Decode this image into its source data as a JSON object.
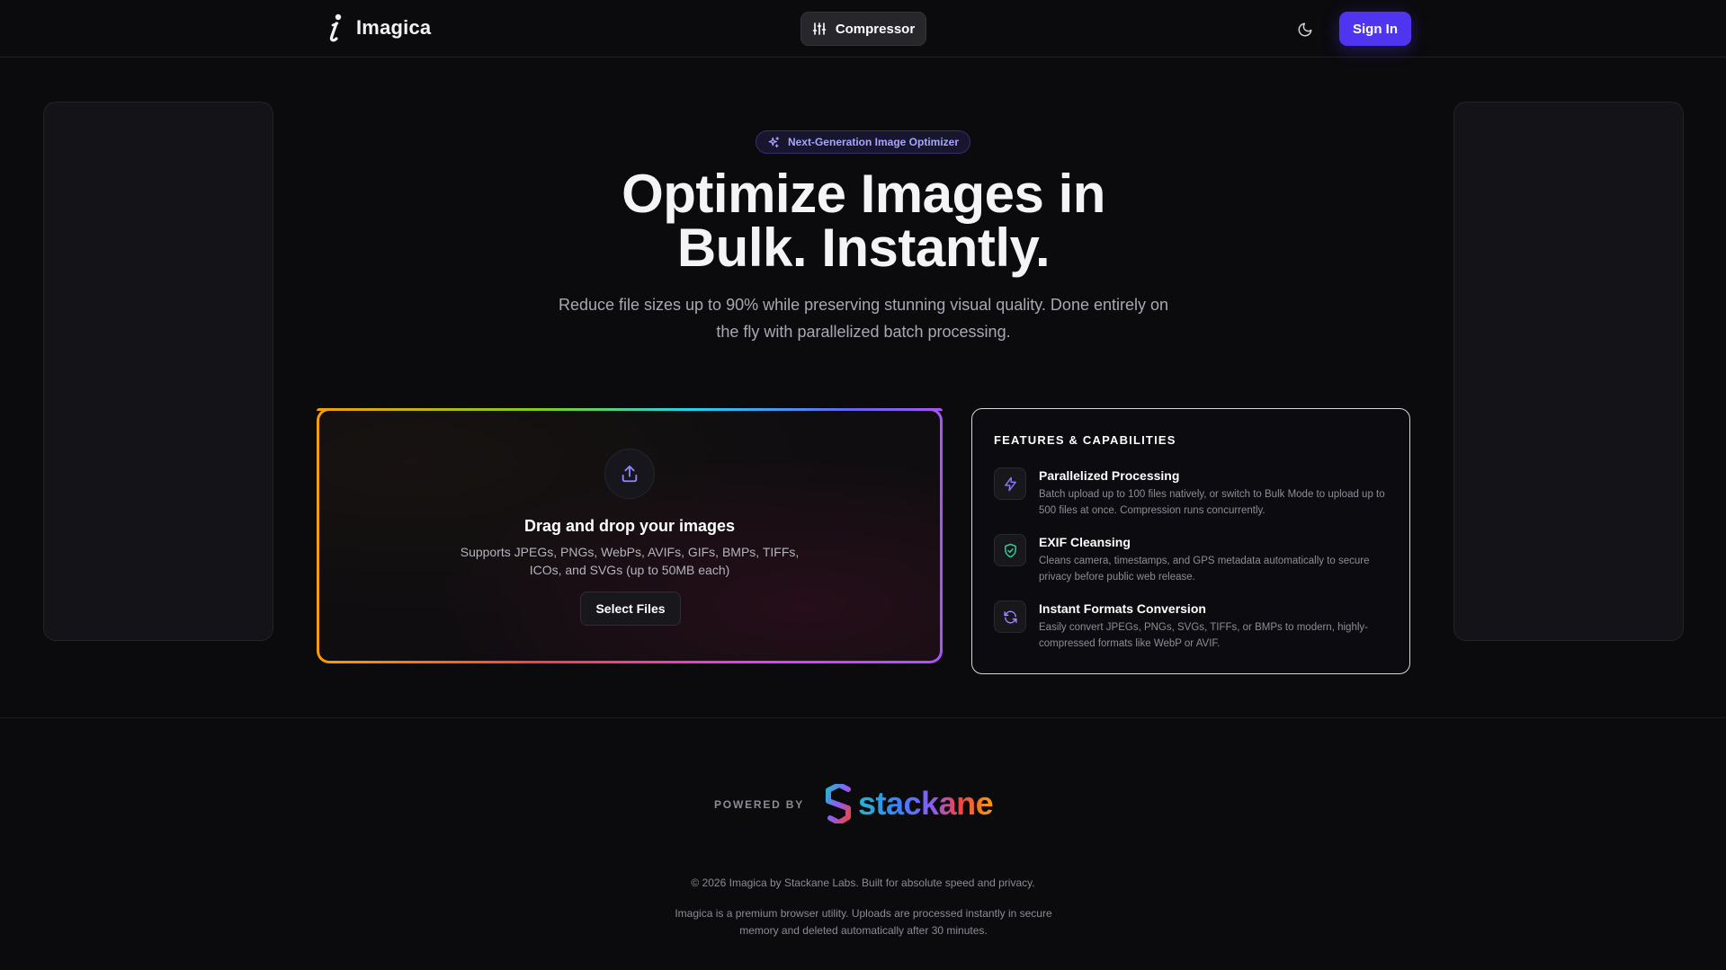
{
  "header": {
    "brand_name": "Imagica",
    "nav_label": "Compressor",
    "signin_label": "Sign In"
  },
  "hero": {
    "badge": "Next-Generation Image Optimizer",
    "title_line1": "Optimize Images in",
    "title_line2": "Bulk. Instantly.",
    "subtitle": "Reduce file sizes up to 90% while preserving stunning visual quality. Done entirely on the fly with parallelized batch processing."
  },
  "upload": {
    "title": "Drag and drop your images",
    "description": "Supports JPEGs, PNGs, WebPs, AVIFs, GIFs, BMPs, TIFFs, ICOs, and SVGs (up to 50MB each)",
    "button_label": "Select Files"
  },
  "features": {
    "title": "FEATURES & CAPABILITIES",
    "items": [
      {
        "name": "Parallelized Processing",
        "description": "Batch upload up to 100 files natively, or switch to Bulk Mode to upload up to 500 files at once. Compression runs concurrently.",
        "icon": "bolt-icon"
      },
      {
        "name": "EXIF Cleansing",
        "description": "Cleans camera, timestamps, and GPS metadata automatically to secure privacy before public web release.",
        "icon": "shield-check-icon"
      },
      {
        "name": "Instant Formats Conversion",
        "description": "Easily convert JPEGs, PNGs, SVGs, TIFFs, or BMPs to modern, highly-compressed formats like WebP or AVIF.",
        "icon": "refresh-icon"
      }
    ]
  },
  "footer": {
    "powered_by": "POWERED BY",
    "partner_name": "stackane",
    "copyright": "© 2026 Imagica by Stackane Labs. Built for absolute speed and privacy.",
    "disclaimer": "Imagica is a premium browser utility. Uploads are processed instantly in secure memory and deleted automatically after 30 minutes."
  },
  "colors": {
    "accent": "#4f35f0",
    "background": "#0b0b0e",
    "badge_text": "#a9a4ff",
    "feature_icon_bolt": "#8b7cff",
    "feature_icon_shield": "#34d399",
    "feature_icon_refresh": "#a78bfa"
  }
}
